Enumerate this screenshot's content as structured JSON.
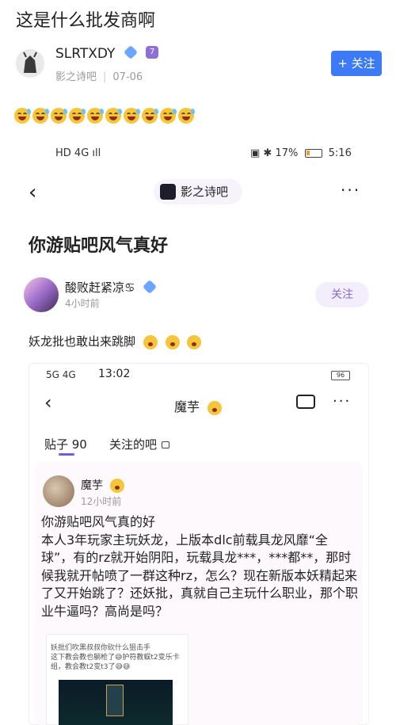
{
  "header": {
    "title": "这是什么批发商啊"
  },
  "poster": {
    "name": "SLRTXDY",
    "forum": "影之诗吧",
    "date": "07-06",
    "follow_label": "+ 关注",
    "level_badge": "7"
  },
  "reaction_emojis": [
    "grinning-sweat",
    "grinning-sweat",
    "grinning-sweat",
    "grinning-sweat",
    "grinning-sweat",
    "grinning-sweat",
    "grinning-sweat",
    "grinning-sweat",
    "grinning-sweat",
    "grinning-sweat"
  ],
  "screenshot": {
    "status_left": "HD 4G ıll",
    "status_battery": "17%",
    "status_time": "5:16",
    "forum_name": "影之诗吧",
    "post_title": "你游贴吧风气真好",
    "author": {
      "name": "酸败赶紧凉♋",
      "time": "4小时前",
      "follow_label": "关注"
    },
    "body": "妖龙批也敢出来跳脚",
    "inner": {
      "status_left": "5G 4G",
      "status_time": "13:02",
      "battery": "96",
      "title": "魔芋",
      "tab_posts": "贴子 90",
      "tab_follow": "关注的吧",
      "card": {
        "name": "魔芋",
        "time": "12小时前",
        "body": "你游贴吧风气真的好\n本人3年玩家主玩妖龙，上版本dlc前载具龙风靡“全球”，有的rz就开始阴阳，玩载具龙***，***都**，那时候我就开帖喷了一群这种rz，怎么？现在新版本妖精起来了又开始跳了？还妖批，真就自己主玩什么职业，那个职业牛逼吗？高尚是吗？",
        "quote": "妖批们吹黑叔叔你砍什么狙击手\n这下教会教也躺枪了😅护符教蜈t2变乐卡组，教会教t2变t3了😅😅"
      }
    }
  },
  "colors": {
    "accent": "#3d7af5",
    "purple": "#8a6ad1"
  }
}
